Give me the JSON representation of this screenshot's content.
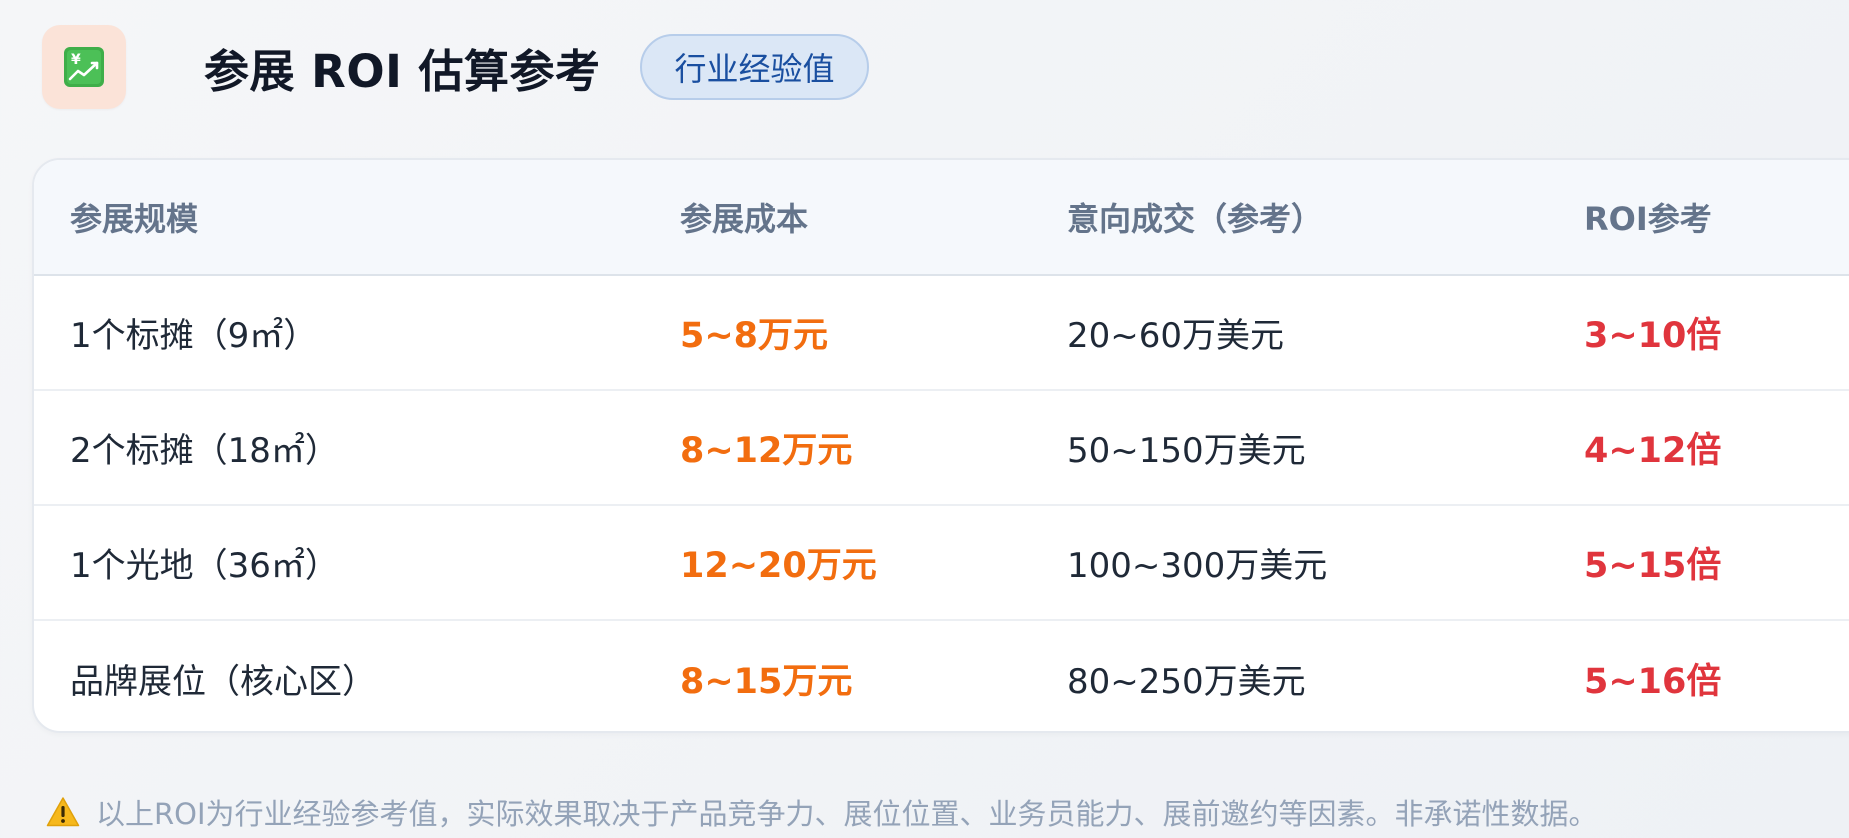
{
  "header": {
    "icon": "chart-yen-icon",
    "title": "参展 ROI 估算参考",
    "badge": "行业经验值"
  },
  "table": {
    "columns": [
      "参展规模",
      "参展成本",
      "意向成交（参考）",
      "ROI参考"
    ],
    "rows": [
      {
        "scale": "1个标摊（9㎡）",
        "cost": "5~8万元",
        "deal": "20~60万美元",
        "roi": "3~10倍"
      },
      {
        "scale": "2个标摊（18㎡）",
        "cost": "8~12万元",
        "deal": "50~150万美元",
        "roi": "4~12倍"
      },
      {
        "scale": "1个光地（36㎡）",
        "cost": "12~20万元",
        "deal": "100~300万美元",
        "roi": "5~15倍"
      },
      {
        "scale": "品牌展位（核心区）",
        "cost": "8~15万元",
        "deal": "80~250万美元",
        "roi": "5~16倍"
      }
    ]
  },
  "footnote": {
    "icon": "warning-icon",
    "text": "以上ROI为行业经验参考值，实际效果取决于产品竞争力、展位位置、业务员能力、展前邀约等因素。非承诺性数据。"
  },
  "colors": {
    "cost": "#f26d0f",
    "roi": "#e0353d",
    "badge_bg": "#dbe7f6",
    "badge_text": "#1a4fa0",
    "icon_tile_bg": "#fbe3d8"
  }
}
